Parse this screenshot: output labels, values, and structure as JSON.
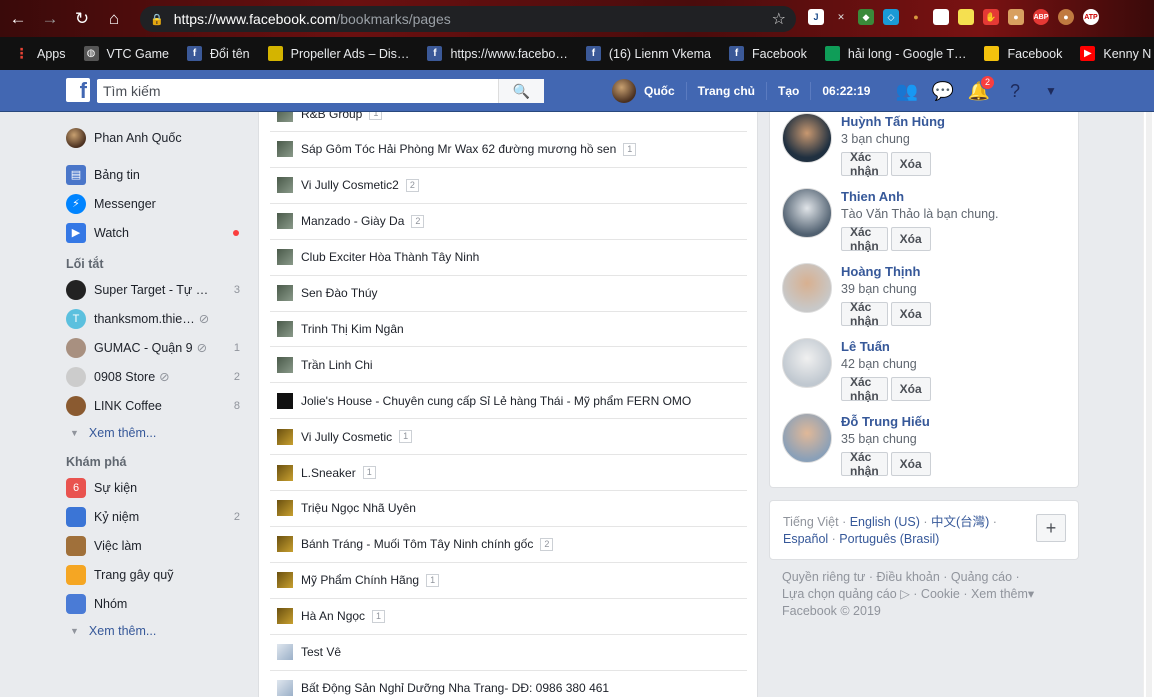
{
  "browser": {
    "url_host": "https://www.facebook.com",
    "url_path": "/bookmarks/pages",
    "bookmarks": [
      {
        "label": "Apps",
        "icon": "apps-grid-icon",
        "color": "#ea4335"
      },
      {
        "label": "VTC Game",
        "icon": "globe-icon",
        "color": "#555"
      },
      {
        "label": "Đổi tên",
        "icon": "facebook-icon",
        "color": "#3b5998"
      },
      {
        "label": "Propeller Ads – Dis…",
        "icon": "propeller-icon",
        "color": "#d4b400"
      },
      {
        "label": "https://www.facebo…",
        "icon": "facebook-icon",
        "color": "#3b5998"
      },
      {
        "label": "(16) Lienm Vkema",
        "icon": "facebook-icon",
        "color": "#3b5998"
      },
      {
        "label": "Facebook",
        "icon": "facebook-icon",
        "color": "#3b5998"
      },
      {
        "label": "hải long - Google T…",
        "icon": "sheets-icon",
        "color": "#0f9d58"
      },
      {
        "label": "Facebook",
        "icon": "folder-icon",
        "color": "#f4c20d"
      },
      {
        "label": "Kenny N - YouTub",
        "icon": "youtube-icon",
        "color": "#ff0000"
      }
    ]
  },
  "fb": {
    "search_placeholder": "Tìm kiếm",
    "profile_name": "Quốc",
    "nav": [
      "Trang chủ",
      "Tạo",
      "06:22:19"
    ],
    "notif_count": "2"
  },
  "left": {
    "user": "Phan Anh Quốc",
    "main": [
      {
        "label": "Bảng tin",
        "icon": "news-feed-icon",
        "color": "#4a76c9"
      },
      {
        "label": "Messenger",
        "icon": "messenger-icon",
        "color": "#0084ff"
      },
      {
        "label": "Watch",
        "icon": "watch-icon",
        "color": "#3578e5",
        "dot": true
      }
    ],
    "shortcuts_title": "Lối tắt",
    "shortcuts": [
      {
        "label": "Super Target - Tự …",
        "count": "3",
        "color": "#222"
      },
      {
        "label": "thanksmom.thie…",
        "count": "",
        "color": "#5bc0de",
        "letter": "T",
        "muted": true
      },
      {
        "label": "GUMAC - Quận 9",
        "count": "1",
        "color": "#a89080",
        "muted": true
      },
      {
        "label": "0908 Store",
        "count": "2",
        "color": "#ccc",
        "muted": true
      },
      {
        "label": "LINK Coffee",
        "count": "8",
        "color": "#8a5a30"
      }
    ],
    "see_more": "Xem thêm...",
    "explore_title": "Khám phá",
    "explore": [
      {
        "label": "Sự kiện",
        "count": "",
        "icon": "calendar-icon",
        "color": "#e9534f",
        "glyph": "6"
      },
      {
        "label": "Kỷ niệm",
        "count": "2",
        "icon": "memories-clock-icon",
        "color": "#3b75d6"
      },
      {
        "label": "Việc làm",
        "count": "",
        "icon": "briefcase-icon",
        "color": "#a0703a"
      },
      {
        "label": "Trang gây quỹ",
        "count": "",
        "icon": "fundraiser-heart-icon",
        "color": "#f5a623"
      },
      {
        "label": "Nhóm",
        "count": "",
        "icon": "groups-icon",
        "color": "#4a7bd6"
      }
    ],
    "see_more2": "Xem thêm..."
  },
  "pages": [
    {
      "name": "R&B Group",
      "count": "1"
    },
    {
      "name": "Sáp Gôm Tóc Hải Phòng Mr Wax 62 đường mương hồ sen",
      "count": "1"
    },
    {
      "name": "Vi Jully Cosmetic2",
      "count": "2"
    },
    {
      "name": "Manzado - Giày Da",
      "count": "2"
    },
    {
      "name": "Club Exciter Hòa Thành Tây Ninh",
      "count": ""
    },
    {
      "name": "Sen Đào Thúy",
      "count": ""
    },
    {
      "name": "Trinh Thị Kim Ngân",
      "count": ""
    },
    {
      "name": "Trần Linh Chi",
      "count": ""
    },
    {
      "name": "Jolie's House - Chuyên cung cấp Sỉ Lẻ hàng Thái - Mỹ phẩm FERN OMO",
      "count": ""
    },
    {
      "name": "Vi Jully Cosmetic",
      "count": "1"
    },
    {
      "name": "L.Sneaker",
      "count": "1"
    },
    {
      "name": "Triệu Ngọc Nhã Uyên",
      "count": ""
    },
    {
      "name": "Bánh Tráng - Muối Tôm Tây Ninh chính gốc",
      "count": "2"
    },
    {
      "name": "Mỹ Phẩm Chính Hãng",
      "count": "1"
    },
    {
      "name": "Hà An Ngọc",
      "count": "1"
    },
    {
      "name": "Test Vê",
      "count": ""
    },
    {
      "name": "Bất Động Sản Nghỉ Dưỡng Nha Trang- DĐ: 0986 380 461",
      "count": ""
    }
  ],
  "requests": [
    {
      "name": "Huỳnh Tấn Hùng",
      "mutual": "3 bạn chung"
    },
    {
      "name": "Thien Anh",
      "mutual": "Tào Văn Thảo là bạn chung."
    },
    {
      "name": "Hoàng Thịnh",
      "mutual": "39 bạn chung"
    },
    {
      "name": "Lê Tuấn",
      "mutual": "42 bạn chung"
    },
    {
      "name": "Đỗ Trung Hiếu",
      "mutual": "35 bạn chung"
    }
  ],
  "confirm_label": "Xác nhận",
  "delete_label": "Xóa",
  "languages": {
    "current": "Tiếng Việt",
    "others": [
      "English (US)",
      "中文(台灣)",
      "Español",
      "Português (Brasil)"
    ]
  },
  "footer": {
    "links": [
      "Quyền riêng tư",
      "Điều khoản",
      "Quảng cáo",
      "Lựa chọn quảng cáo",
      "Cookie",
      "Xem thêm"
    ],
    "copyright": "Facebook © 2019"
  }
}
